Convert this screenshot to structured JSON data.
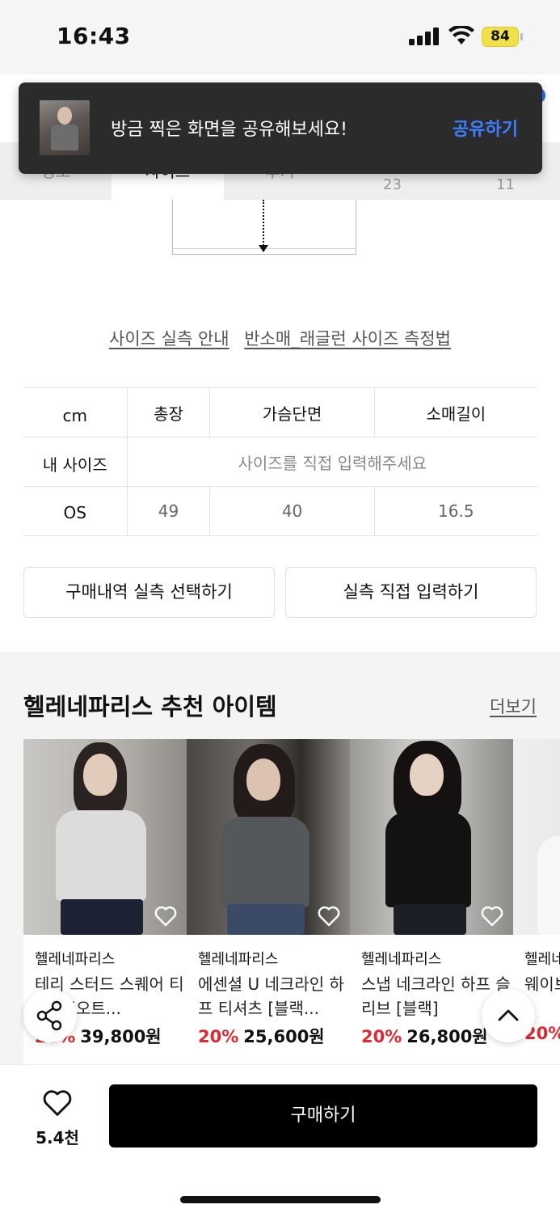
{
  "status_bar": {
    "time": "16:43",
    "battery": "84"
  },
  "tabs": [
    {
      "label": "정보"
    },
    {
      "label": "사이즈"
    },
    {
      "label": "후기"
    },
    {
      "label": "",
      "count": "23"
    },
    {
      "label": "",
      "count": "11"
    }
  ],
  "toast": {
    "message": "방금 찍은 화면을 공유해보세요!",
    "action": "공유하기"
  },
  "size_guide": {
    "link_measure": "사이즈 실측 안내",
    "link_method": "반소매_래글런 사이즈 측정법"
  },
  "size_table": {
    "headers": [
      "cm",
      "총장",
      "가슴단면",
      "소매길이"
    ],
    "my_size_label": "내 사이즈",
    "my_size_placeholder": "사이즈를 직접 입력해주세요",
    "rows": [
      {
        "size": "OS",
        "values": [
          "49",
          "40",
          "16.5"
        ]
      }
    ]
  },
  "buttons": {
    "select_history": "구매내역 실측 선택하기",
    "enter_direct": "실측 직접 입력하기"
  },
  "recommendations": {
    "title": "헬레네파리스 추천 아이템",
    "more": "더보기",
    "items": [
      {
        "brand": "헬레네파리스",
        "name": "테리 스터드 스퀘어 티셔츠 [오트...",
        "discount": "20%",
        "price": "39,800원"
      },
      {
        "brand": "헬레네파리스",
        "name": "에센셜 U 네크라인 하프 티셔츠 [블랙...",
        "discount": "20%",
        "price": "25,600원"
      },
      {
        "brand": "헬레네파리스",
        "name": "스냅 네크라인 하프 슬리브 [블랙]",
        "discount": "20%",
        "price": "26,800원"
      },
      {
        "brand": "헬레네파리스",
        "name": "웨이브 ...",
        "discount": "20%",
        "price": ""
      }
    ]
  },
  "bottom_bar": {
    "like_count": "5.4천",
    "buy_label": "구매하기"
  },
  "colors": {
    "accent": "#3d7dff",
    "discount": "#e3262f",
    "buy_button": "#000000"
  }
}
